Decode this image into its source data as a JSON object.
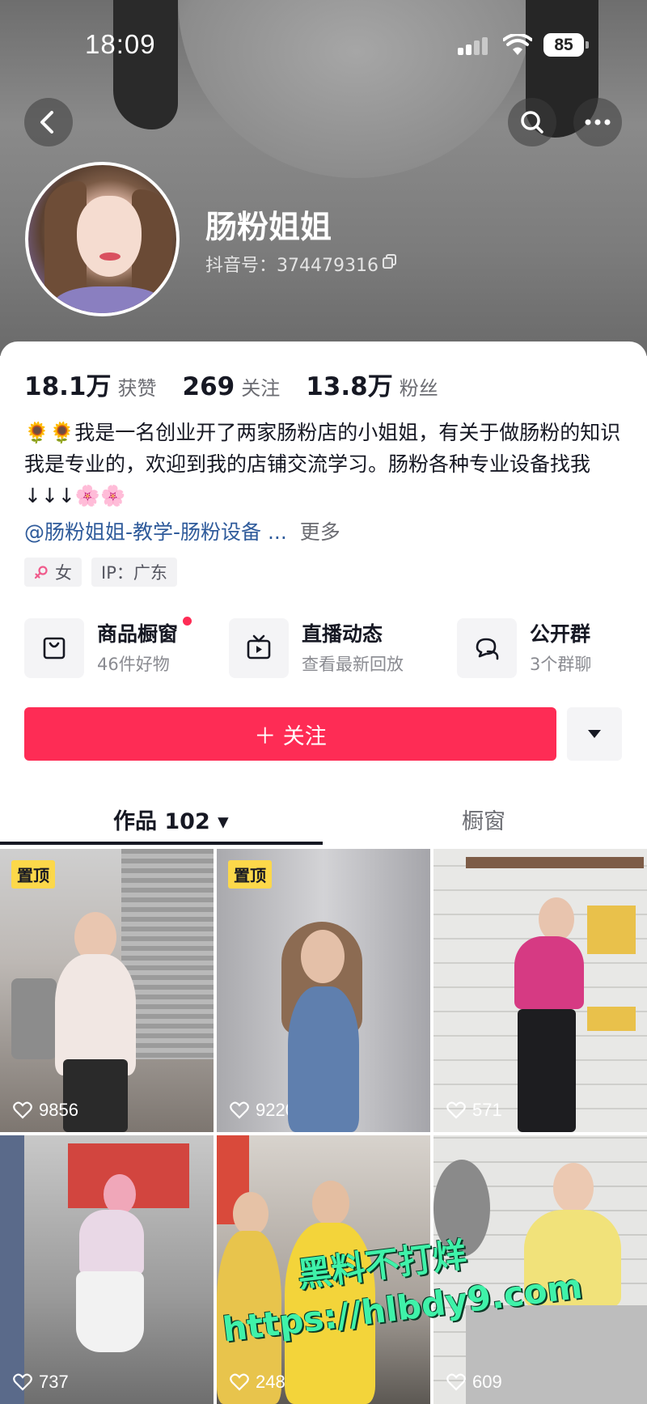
{
  "status_bar": {
    "time": "18:09",
    "battery": "85"
  },
  "profile": {
    "nickname": "肠粉姐姐",
    "douyin_id": "抖音号：374479316"
  },
  "stats": [
    {
      "value": "18.1万",
      "label": "获赞"
    },
    {
      "value": "269",
      "label": "关注"
    },
    {
      "value": "13.8万",
      "label": "粉丝"
    }
  ],
  "bio": {
    "text": "🌻🌻我是一名创业开了两家肠粉店的小姐姐，有关于做肠粉的知识我是专业的，欢迎到我的店铺交流学习。肠粉各种专业设备找我↓↓↓🌸🌸",
    "link": "@肠粉姐姐-教学-肠粉设备 ...",
    "more": "更多"
  },
  "tags": [
    {
      "icon": "female-icon",
      "label": "女"
    },
    {
      "label": "IP：广东"
    }
  ],
  "shortcuts": [
    {
      "title": "商品橱窗",
      "subtitle": "46件好物",
      "icon": "shopping-bag-icon"
    },
    {
      "title": "直播动态",
      "subtitle": "查看最新回放",
      "icon": "tv-icon"
    },
    {
      "title": "公开群",
      "subtitle": "3个群聊",
      "icon": "chat-icon"
    }
  ],
  "follow_button": "＋ 关注",
  "tabs": [
    {
      "label": "作品 102 ▾",
      "active": true
    },
    {
      "label": "橱窗",
      "active": false
    }
  ],
  "videos": [
    {
      "pinned": "置顶",
      "likes": "9856"
    },
    {
      "pinned": "置顶",
      "likes": "9220"
    },
    {
      "likes": "571"
    },
    {
      "likes": "737"
    },
    {
      "likes": "248"
    },
    {
      "likes": "609"
    }
  ],
  "watermark": {
    "line1": "黑料不打烊",
    "line2": "https://hlbdy9.com"
  },
  "colors": {
    "accent": "#fe2c55",
    "link": "#2f5b9b",
    "pin_badge": "#fcd84a",
    "watermark": "#3ff2a9"
  }
}
